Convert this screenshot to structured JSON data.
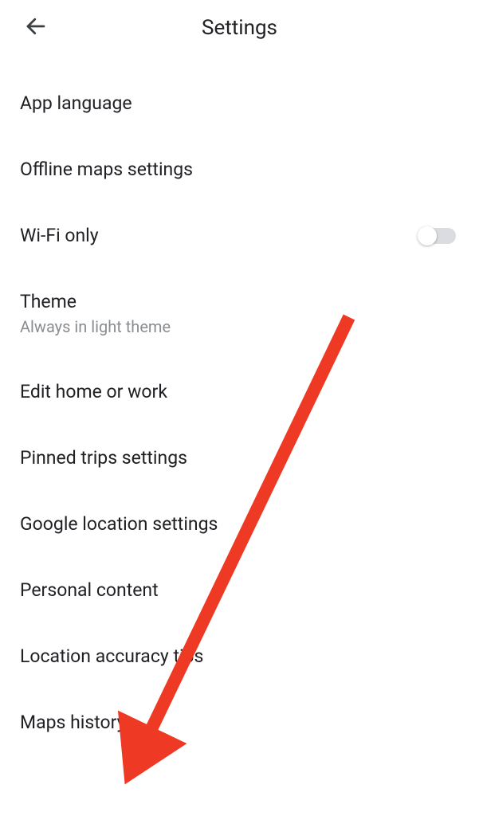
{
  "header": {
    "title": "Settings"
  },
  "items": {
    "app_language": {
      "label": "App language"
    },
    "offline_maps": {
      "label": "Offline maps settings"
    },
    "wifi_only": {
      "label": "Wi-Fi only",
      "toggle": "off"
    },
    "theme": {
      "label": "Theme",
      "subtitle": "Always in light theme"
    },
    "edit_home_work": {
      "label": "Edit home or work"
    },
    "pinned_trips": {
      "label": "Pinned trips settings"
    },
    "google_location": {
      "label": "Google location settings"
    },
    "personal_content": {
      "label": "Personal content"
    },
    "location_accuracy": {
      "label": "Location accuracy tips"
    },
    "maps_history": {
      "label": "Maps history"
    }
  },
  "annotation_arrow_color": "#ee3a24"
}
